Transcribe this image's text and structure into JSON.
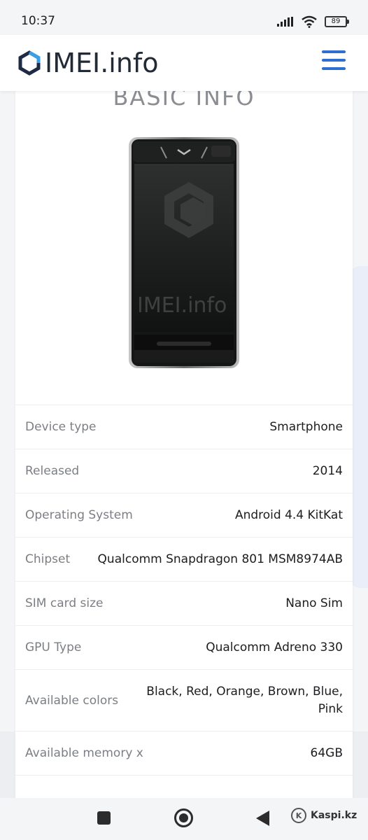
{
  "status_bar": {
    "time": "10:37",
    "battery": "89"
  },
  "header": {
    "logo_text": "IMEI.info",
    "menu_icon": "hamburger-menu-icon"
  },
  "section": {
    "title": "BASIC INFO"
  },
  "product_image": {
    "watermark": "IMEI.info"
  },
  "specs": [
    {
      "label": "Device type",
      "value": "Smartphone"
    },
    {
      "label": "Released",
      "value": "2014"
    },
    {
      "label": "Operating System",
      "value": "Android 4.4 KitKat"
    },
    {
      "label": "Chipset",
      "value": "Qualcomm Snapdragon 801 MSM8974AB"
    },
    {
      "label": "SIM card size",
      "value": "Nano Sim"
    },
    {
      "label": "GPU Type",
      "value": "Qualcomm Adreno 330"
    },
    {
      "label": "Available colors",
      "value": "Black, Red, Orange, Brown, Blue, Pink"
    },
    {
      "label": "Available memory x",
      "value": "64GB"
    }
  ],
  "watermark": {
    "text": "Kaspi.kz"
  },
  "colors": {
    "accent": "#2f6fd1",
    "logo_ring": "#3aa0e6"
  }
}
